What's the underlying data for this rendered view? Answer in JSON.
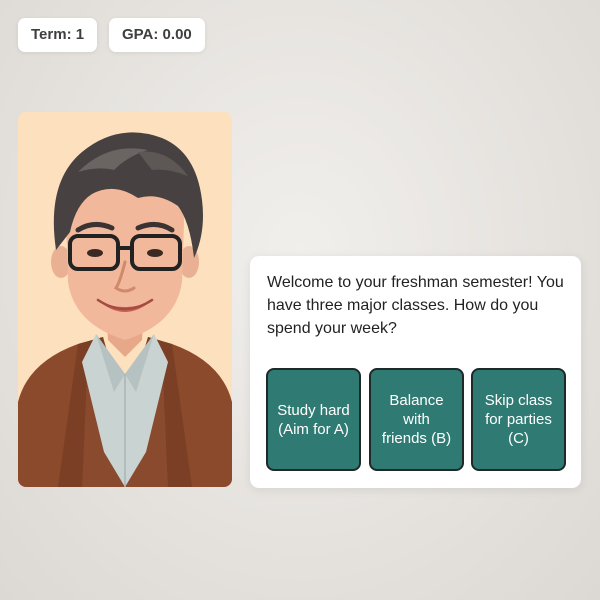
{
  "stats": {
    "term": "Term: 1",
    "gpa": "GPA: 0.00"
  },
  "portrait": {
    "icon": "professor-portrait",
    "background_color": "#fde2c0"
  },
  "dialog": {
    "message": "Welcome to your freshman semester! You have three major classes. How do you spend your week?",
    "choices": [
      {
        "label": "Study hard (Aim for A)"
      },
      {
        "label": "Balance with friends (B)"
      },
      {
        "label": "Skip class for parties (C)"
      }
    ]
  },
  "colors": {
    "button_fill": "#2f7b73",
    "button_border": "#1d2a28",
    "panel": "#ffffff"
  }
}
